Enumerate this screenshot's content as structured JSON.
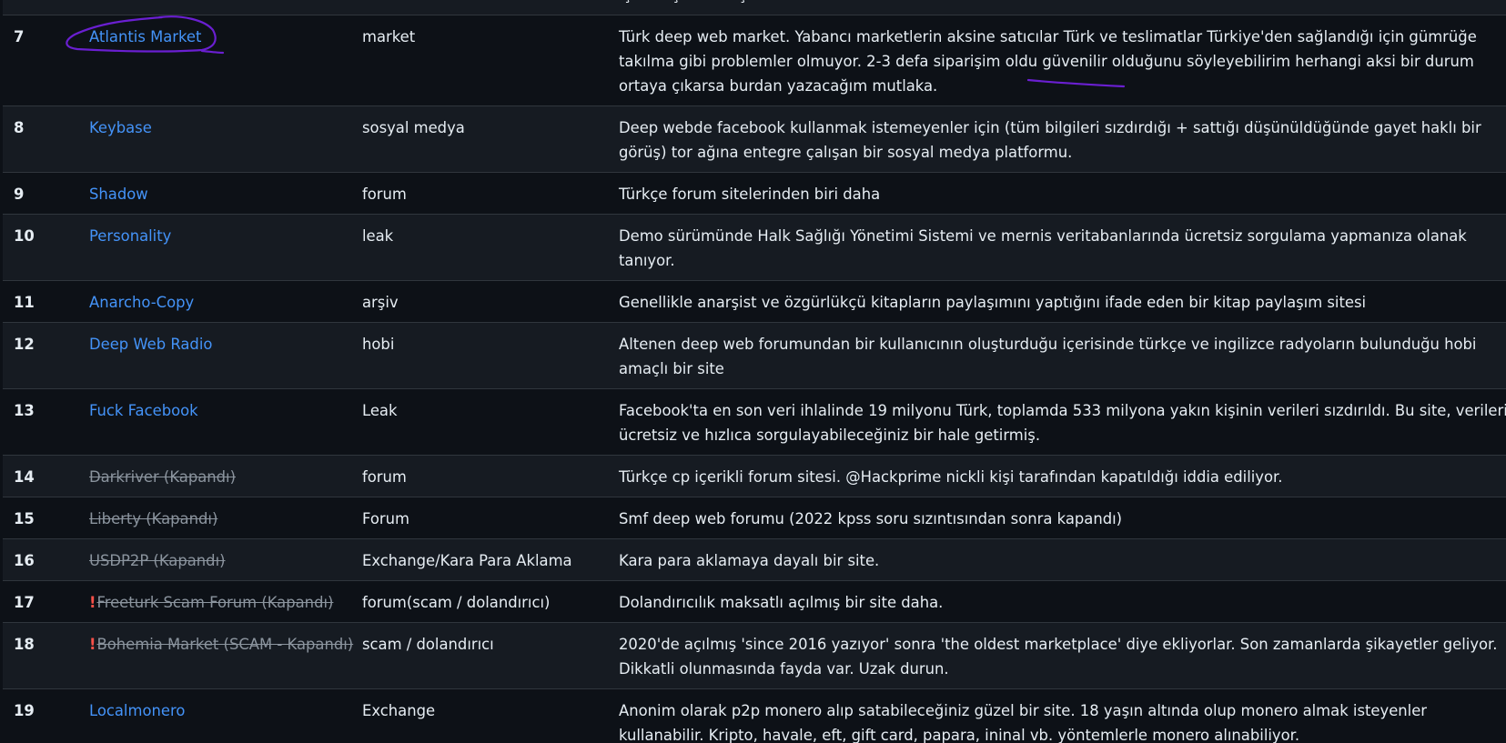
{
  "table": {
    "rows": [
      {
        "num": "",
        "name": "",
        "category": "",
        "description": "için oluşturulmuş",
        "closed": false,
        "scam": false
      },
      {
        "num": "7",
        "name": "Atlantis Market",
        "category": "market",
        "description": "Türk deep web market. Yabancı marketlerin aksine satıcılar Türk ve teslimatlar Türkiye'den sağlandığı için gümrüğe takılma gibi problemler olmuyor. 2-3 defa siparişim oldu güvenilir olduğunu söyleyebilirim herhangi aksi bir durum ortaya çıkarsa burdan yazacağım mutlaka.",
        "closed": false,
        "scam": false
      },
      {
        "num": "8",
        "name": "Keybase",
        "category": "sosyal medya",
        "description": "Deep webde facebook kullanmak istemeyenler için (tüm bilgileri sızdırdığı + sattığı düşünüldüğünde gayet haklı bir görüş) tor ağına entegre çalışan bir sosyal medya platformu.",
        "closed": false,
        "scam": false
      },
      {
        "num": "9",
        "name": "Shadow",
        "category": "forum",
        "description": "Türkçe forum sitelerinden biri daha",
        "closed": false,
        "scam": false
      },
      {
        "num": "10",
        "name": "Personality",
        "category": "leak",
        "description": "Demo sürümünde Halk Sağlığı Yönetimi Sistemi ve mernis veritabanlarında ücretsiz sorgulama yapmanıza olanak tanıyor.",
        "closed": false,
        "scam": false
      },
      {
        "num": "11",
        "name": "Anarcho-Copy",
        "category": "arşiv",
        "description": "Genellikle anarşist ve özgürlükçü kitapların paylaşımını yaptığını ifade eden bir kitap paylaşım sitesi",
        "closed": false,
        "scam": false
      },
      {
        "num": "12",
        "name": "Deep Web Radio",
        "category": "hobi",
        "description": "Altenen deep web forumundan bir kullanıcının oluşturduğu içerisinde türkçe ve ingilizce radyoların bulunduğu hobi amaçlı bir site",
        "closed": false,
        "scam": false
      },
      {
        "num": "13",
        "name": "Fuck Facebook",
        "category": "Leak",
        "description": "Facebook'ta en son veri ihlalinde 19 milyonu Türk, toplamda 533 milyona yakın kişinin verileri sızdırıldı. Bu site, verileri ücretsiz ve hızlıca sorgulayabileceğiniz bir hale getirmiş.",
        "closed": false,
        "scam": false
      },
      {
        "num": "14",
        "name": "Darkriver (Kapandı)",
        "category": "forum",
        "description": "Türkçe cp içerikli forum sitesi. @Hackprime nickli kişi tarafından kapatıldığı iddia ediliyor.",
        "closed": true,
        "scam": false
      },
      {
        "num": "15",
        "name": "Liberty (Kapandı)",
        "category": "Forum",
        "description": "Smf deep web forumu (2022 kpss soru sızıntısından sonra kapandı)",
        "closed": true,
        "scam": false
      },
      {
        "num": "16",
        "name": "USDP2P (Kapandı)",
        "category": "Exchange/Kara Para Aklama",
        "description": "Kara para aklamaya dayalı bir site.",
        "closed": true,
        "scam": false
      },
      {
        "num": "17",
        "name": "Freeturk Scam Forum (Kapandı)",
        "category": "forum(scam / dolandırıcı)",
        "description": "Dolandırıcılık maksatlı açılmış bir site daha.",
        "closed": true,
        "scam": true
      },
      {
        "num": "18",
        "name": "Bohemia Market (SCAM - Kapandı)",
        "category": "scam / dolandırıcı",
        "description": "2020'de açılmış 'since 2016 yazıyor' sonra 'the oldest marketplace' diye ekliyorlar. Son zamanlarda şikayetler geliyor. Dikkatli olunmasında fayda var. Uzak durun.",
        "closed": true,
        "scam": true
      },
      {
        "num": "19",
        "name": "Localmonero",
        "category": "Exchange",
        "description": "Anonim olarak p2p monero alıp satabileceğiniz güzel bir site. 18 yaşın altında olup monero almak isteyenler kullanabilir. Kripto, havale, eft, gift card, papara, ininal vb. yöntemlerle monero alınabiliyor.",
        "closed": false,
        "scam": false
      }
    ]
  },
  "icons": {
    "warning": "!"
  },
  "colors": {
    "background": "#0d1117",
    "row_alt": "#161b22",
    "link": "#4493f8",
    "closed_link": "#8b949e",
    "warning": "#f85149",
    "annotation": "#6a1fd1"
  }
}
